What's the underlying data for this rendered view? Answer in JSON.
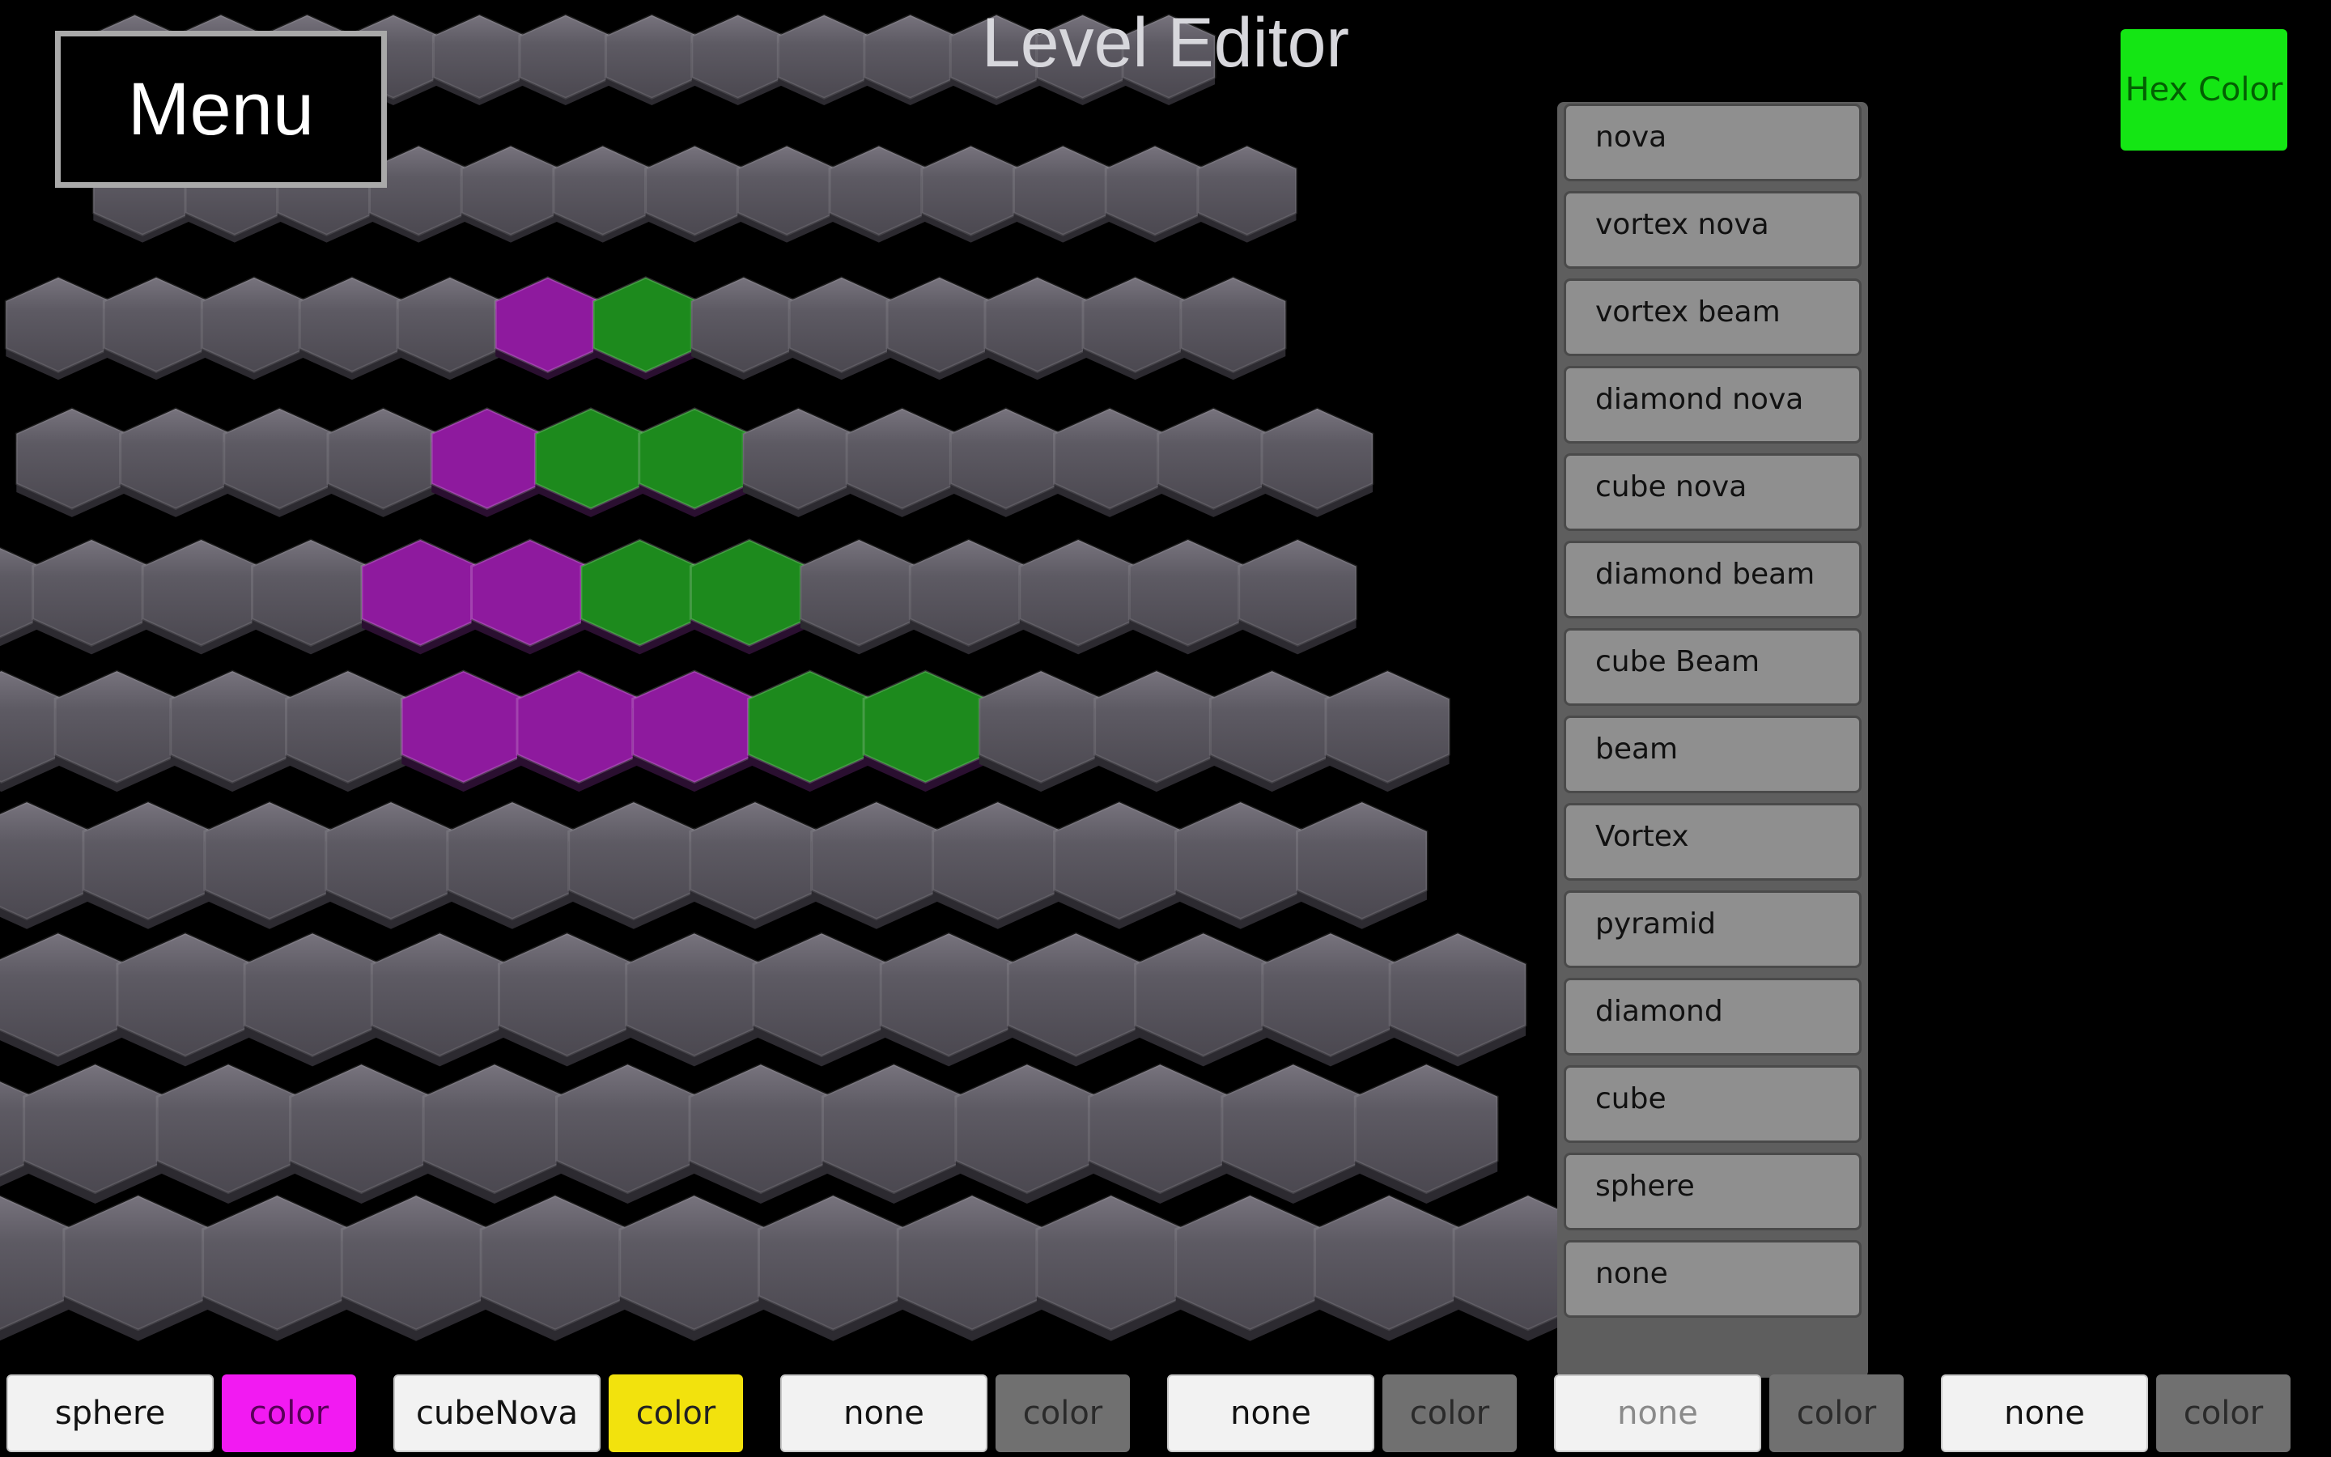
{
  "header": {
    "title": "Level Editor"
  },
  "menu": {
    "label": "Menu"
  },
  "hex_color_button": {
    "label": "Hex Color",
    "color": "#14e614"
  },
  "board": {
    "tile_color": "#59565f",
    "colors": {
      "P": "#8e1a9e",
      "G": "#1d8a1d"
    },
    "rows": [
      "...........",
      "...........",
      "....PG.....",
      "...PGG.....",
      "...PPGG....",
      "...PPPGG...",
      "...........",
      "...........",
      "...........",
      "..........."
    ]
  },
  "shape_dropdown": {
    "options": [
      "nova",
      "vortex nova",
      "vortex beam",
      "diamond nova",
      "cube nova",
      "diamond beam",
      "cube Beam",
      "beam",
      "Vortex",
      "pyramid",
      "diamond",
      "cube",
      "sphere",
      "none"
    ]
  },
  "slots": [
    {
      "shape": "sphere",
      "color_label": "color",
      "color": "#f21af2",
      "text_color": "#5a005a"
    },
    {
      "shape": "cubeNova",
      "color_label": "color",
      "color": "#f2e20d",
      "text_color": "#222222"
    },
    {
      "shape": "none",
      "color_label": "color",
      "color": "#707070",
      "text_color": "#2a2a2a"
    },
    {
      "shape": "none",
      "color_label": "color",
      "color": "#707070",
      "text_color": "#2a2a2a"
    },
    {
      "shape": "none",
      "color_label": "color",
      "color": "#707070",
      "text_color": "#2a2a2a",
      "dimmed": true
    },
    {
      "shape": "none",
      "color_label": "color",
      "color": "#707070",
      "text_color": "#2a2a2a"
    }
  ]
}
